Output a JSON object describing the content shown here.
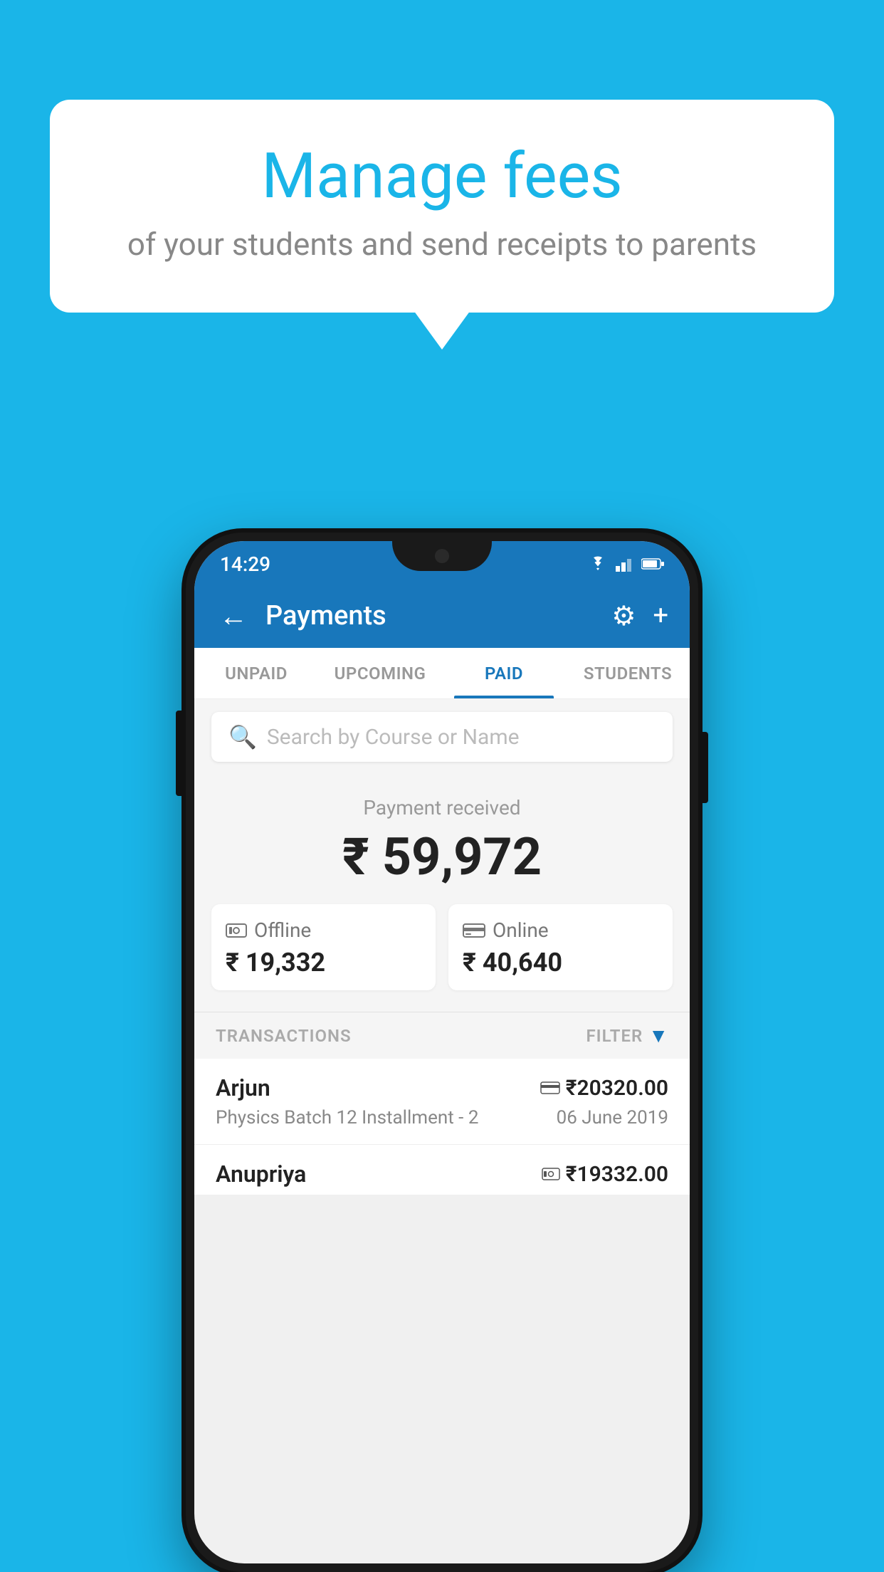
{
  "background_color": "#1ab5e8",
  "bubble": {
    "title": "Manage fees",
    "subtitle": "of your students and send receipts to parents"
  },
  "status_bar": {
    "time": "14:29",
    "wifi": "▲",
    "signal": "▲",
    "battery": "▉"
  },
  "header": {
    "title": "Payments",
    "back_label": "←",
    "gear_label": "⚙",
    "plus_label": "+"
  },
  "tabs": [
    {
      "id": "unpaid",
      "label": "UNPAID",
      "active": false
    },
    {
      "id": "upcoming",
      "label": "UPCOMING",
      "active": false
    },
    {
      "id": "paid",
      "label": "PAID",
      "active": true
    },
    {
      "id": "students",
      "label": "STUDENTS",
      "active": false
    }
  ],
  "search": {
    "placeholder": "Search by Course or Name"
  },
  "payment_summary": {
    "label": "Payment received",
    "total": "₹ 59,972",
    "offline_label": "Offline",
    "offline_amount": "₹ 19,332",
    "online_label": "Online",
    "online_amount": "₹ 40,640"
  },
  "transactions_section": {
    "label": "TRANSACTIONS",
    "filter_label": "FILTER"
  },
  "transactions": [
    {
      "name": "Arjun",
      "detail": "Physics Batch 12 Installment - 2",
      "amount": "₹20320.00",
      "date": "06 June 2019",
      "payment_type": "card"
    },
    {
      "name": "Anupriya",
      "amount": "₹19332.00",
      "payment_type": "cash"
    }
  ]
}
